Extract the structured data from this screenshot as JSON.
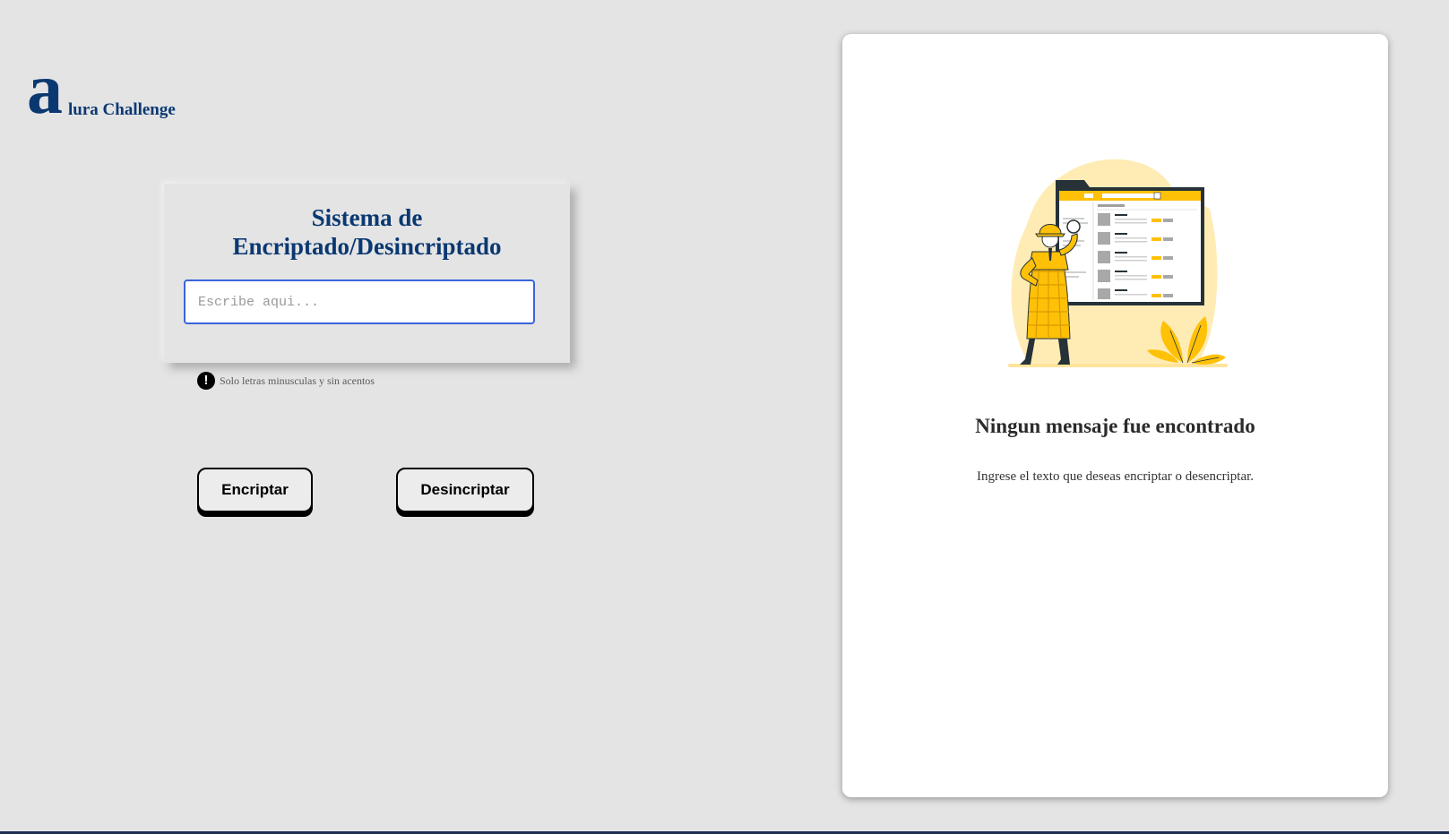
{
  "logo": {
    "mark": "a",
    "text": "lura Challenge"
  },
  "encrypt_card": {
    "title": "Sistema de\nEncriptado/Desincriptado",
    "input_placeholder": "Escribe aqui...",
    "input_value": ""
  },
  "hint": {
    "icon": "exclamation-circle-icon",
    "text": "Solo letras minusculas y sin acentos"
  },
  "buttons": {
    "encrypt_label": "Encriptar",
    "decrypt_label": "Desincriptar"
  },
  "result_panel": {
    "illustration": "detective-search-illustration",
    "title": "Ningun mensaje fue encontrado",
    "subtitle": "Ingrese el texto que deseas encriptar o desencriptar."
  },
  "colors": {
    "background": "#e4e4e5",
    "brand_blue": "#0a3871",
    "input_border": "#3b63db",
    "accent_yellow": "#ffc107"
  }
}
